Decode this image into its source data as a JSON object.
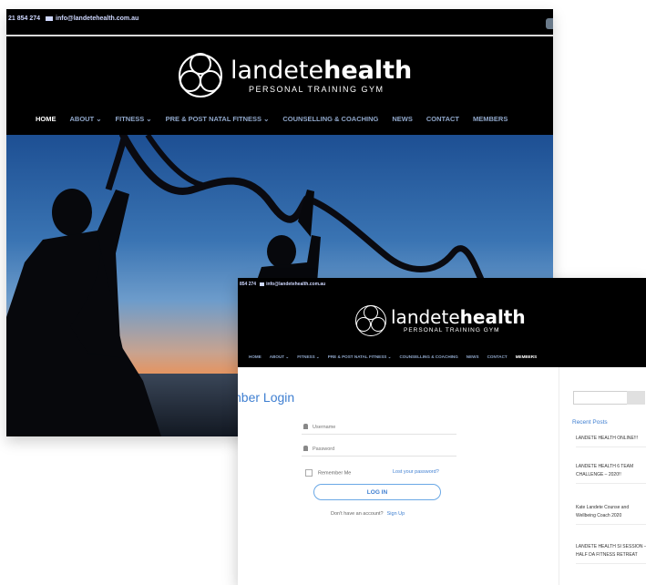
{
  "home": {
    "contact": {
      "phone": "21 854 274",
      "email": "info@landetehealth.com.au"
    },
    "logo": {
      "brand_thin": "landete",
      "brand_bold": "health",
      "tagline": "PERSONAL TRAINING GYM"
    },
    "nav": [
      "HOME",
      "ABOUT ⌄",
      "FITNESS ⌄",
      "PRE & POST NATAL FITNESS ⌄",
      "COUNSELLING & COACHING",
      "NEWS",
      "CONTACT",
      "MEMBERS"
    ]
  },
  "member": {
    "contact": {
      "phone": "854 274",
      "email": "info@landetehealth.com.au"
    },
    "logo": {
      "brand_thin": "landete",
      "brand_bold": "health",
      "tagline": "PERSONAL TRAINING GYM"
    },
    "nav": [
      "HOME",
      "ABOUT ⌄",
      "FITNESS ⌄",
      "PRE & POST NATAL FITNESS ⌄",
      "COUNSELLING & COACHING",
      "NEWS",
      "CONTACT",
      "MEMBERS"
    ],
    "heading": "nber Login",
    "username_placeholder": "Username",
    "password_placeholder": "Password",
    "remember_label": "Remember Me",
    "lost_password": "Lost your password?",
    "login_button": "LOG IN",
    "no_account": "Don't have an account?",
    "signup_link": "Sign Up",
    "recent_title": "Recent Posts",
    "posts": [
      "LANDETE HEALTH ONLINE!!!",
      "LANDETE HEALTH 6 TEAM CHALLENGE – 2020!!",
      "Kate Landete Counse and Wellbeing Coach 2020",
      "LANDETE HEALTH SI SESSION – HALF DA FITNESS RETREAT"
    ]
  }
}
